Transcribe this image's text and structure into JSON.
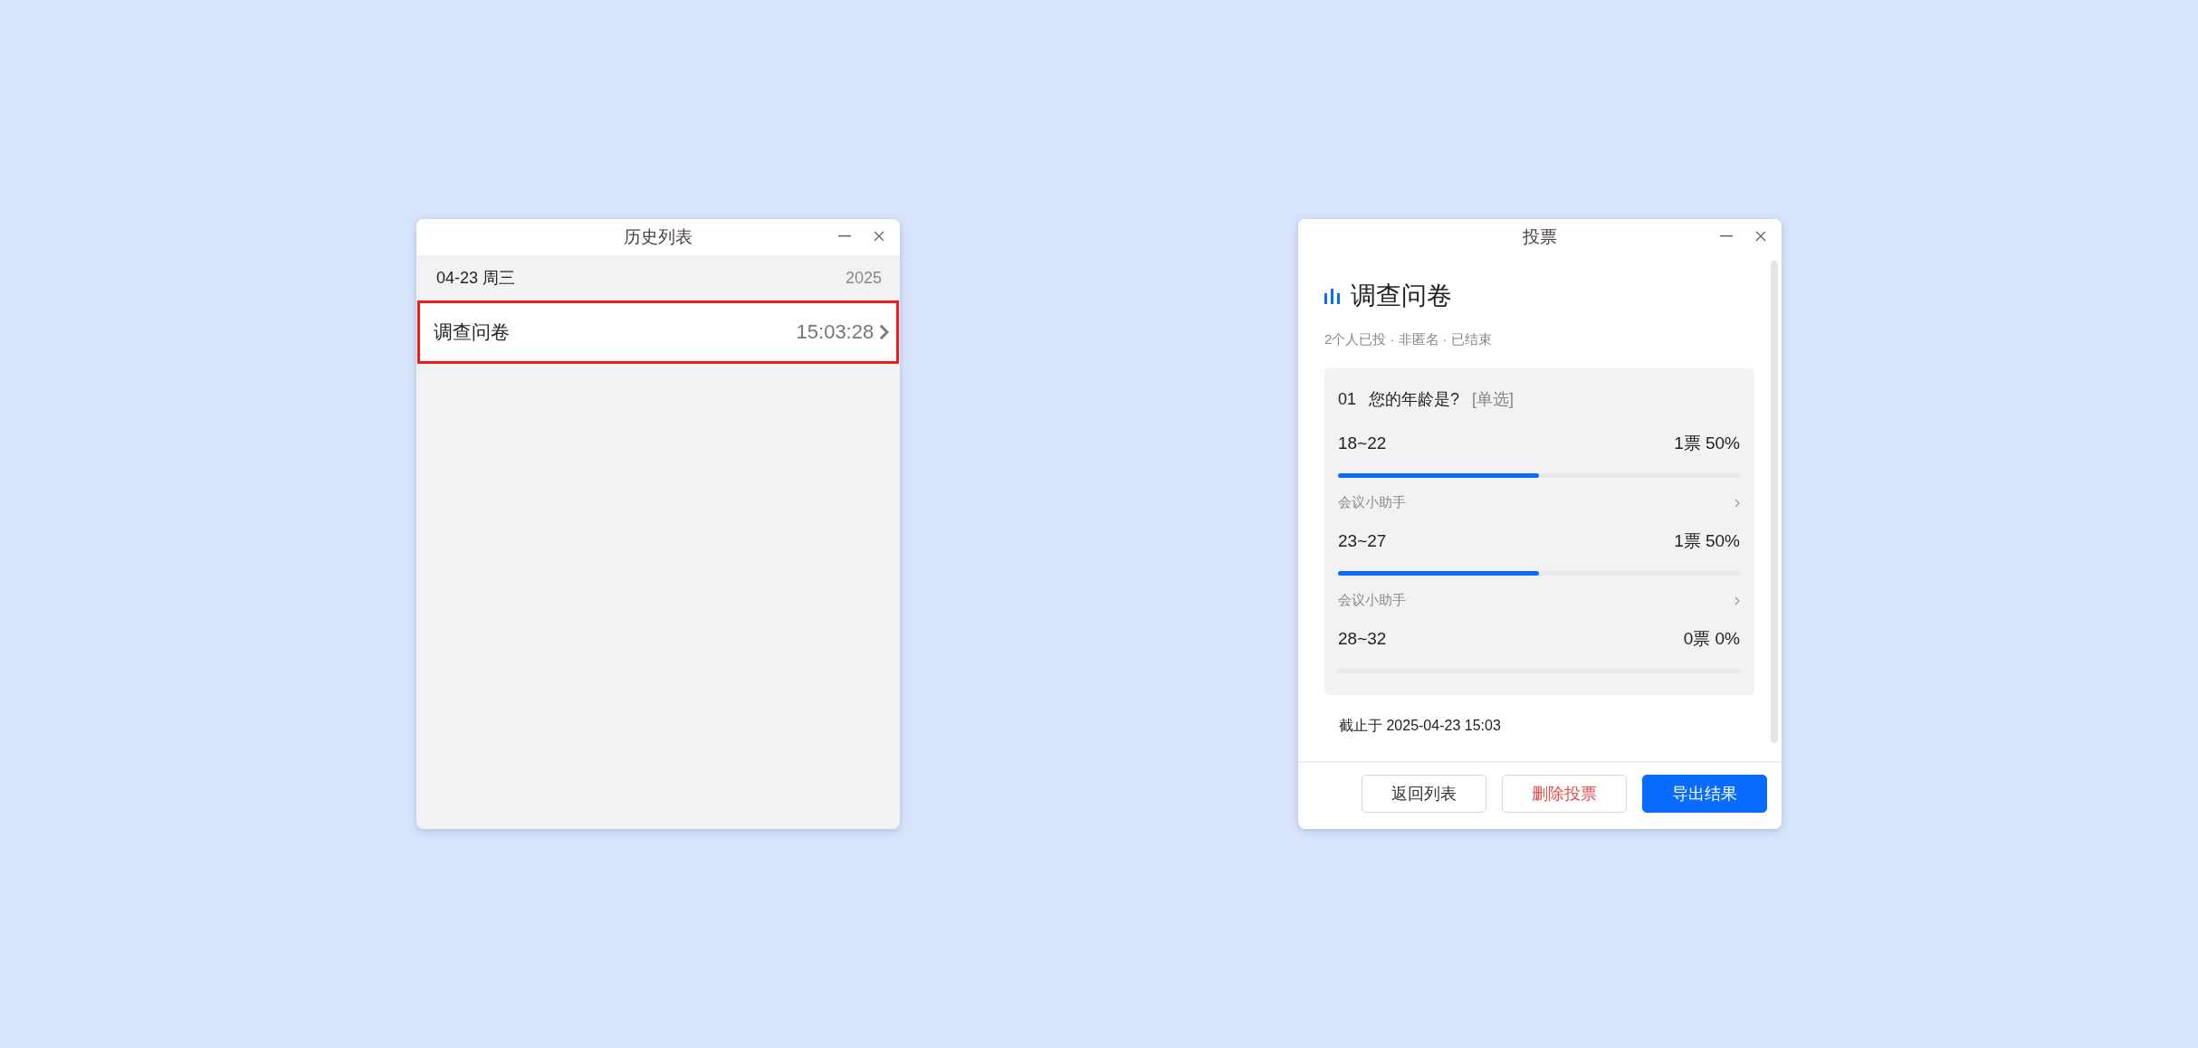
{
  "history_window": {
    "title": "历史列表",
    "date_group": {
      "date": "04-23 周三",
      "year": "2025"
    },
    "items": [
      {
        "title": "调查问卷",
        "time": "15:03:28",
        "selected": true
      }
    ]
  },
  "vote_window": {
    "title": "投票",
    "poll_title": "调查问卷",
    "summary": "2个人已投 · 非匿名 · 已结束",
    "questions": [
      {
        "number": "01",
        "text": "您的年龄是?",
        "type": "[单选]",
        "options": [
          {
            "label": "18~22",
            "result": "1票 50%",
            "level": 0.5,
            "voters": [
              "会议小助手"
            ]
          },
          {
            "label": "23~27",
            "result": "1票 50%",
            "level": 0.5,
            "voters": [
              "会议小助手"
            ]
          },
          {
            "label": "28~32",
            "result": "0票 0%",
            "level": 0
          }
        ]
      }
    ],
    "deadline": "截止于 2025-04-23 15:03",
    "buttons": [
      {
        "label": "返回列表",
        "kind": "default"
      },
      {
        "label": "删除投票",
        "kind": "danger"
      },
      {
        "label": "导出结果",
        "kind": "primary"
      }
    ]
  }
}
